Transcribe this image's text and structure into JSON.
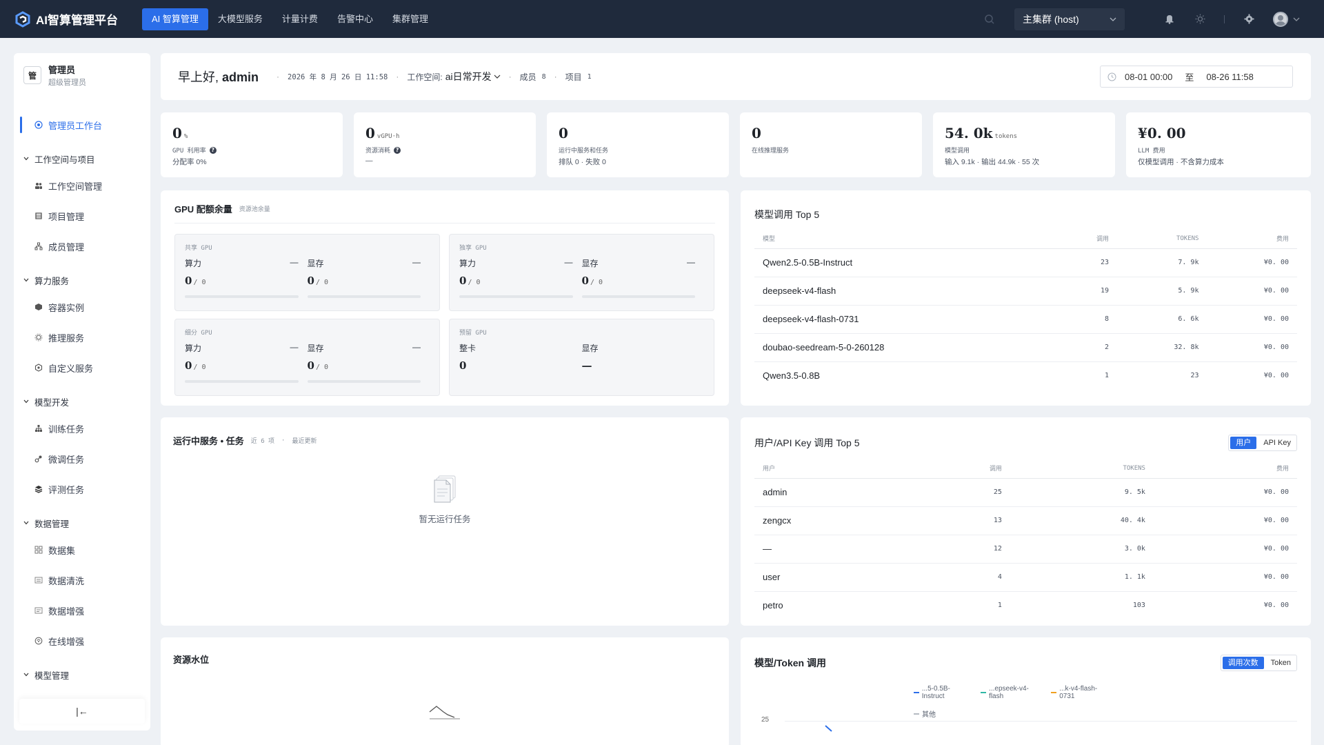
{
  "app": {
    "title": "AI智算管理平台"
  },
  "topnav": {
    "items": [
      {
        "label": "AI 智算管理",
        "active": true
      },
      {
        "label": "大模型服务",
        "active": false
      },
      {
        "label": "计量计费",
        "active": false
      },
      {
        "label": "告警中心",
        "active": false
      },
      {
        "label": "集群管理",
        "active": false
      }
    ],
    "cluster": "主集群 (host)"
  },
  "sidebar": {
    "admin": {
      "initial": "管",
      "name": "管理员",
      "role": "超级管理员"
    },
    "items": [
      {
        "label": "管理员工作台",
        "type": "item",
        "active": true,
        "icon": "dashboard-icon"
      },
      {
        "label": "工作空间与项目",
        "type": "group"
      },
      {
        "label": "工作空间管理",
        "type": "item",
        "icon": "workspace-icon"
      },
      {
        "label": "项目管理",
        "type": "item",
        "icon": "project-icon"
      },
      {
        "label": "成员管理",
        "type": "item",
        "icon": "members-icon"
      },
      {
        "label": "算力服务",
        "type": "group"
      },
      {
        "label": "容器实例",
        "type": "item",
        "icon": "container-icon"
      },
      {
        "label": "推理服务",
        "type": "item",
        "icon": "inference-icon"
      },
      {
        "label": "自定义服务",
        "type": "item",
        "icon": "custom-service-icon"
      },
      {
        "label": "模型开发",
        "type": "group"
      },
      {
        "label": "训练任务",
        "type": "item",
        "icon": "training-icon"
      },
      {
        "label": "微调任务",
        "type": "item",
        "icon": "finetune-icon"
      },
      {
        "label": "评测任务",
        "type": "item",
        "icon": "evaluation-icon"
      },
      {
        "label": "数据管理",
        "type": "group"
      },
      {
        "label": "数据集",
        "type": "item",
        "icon": "dataset-icon"
      },
      {
        "label": "数据清洗",
        "type": "item",
        "icon": "data-clean-icon"
      },
      {
        "label": "数据增强",
        "type": "item",
        "icon": "data-augment-icon"
      },
      {
        "label": "在线增强",
        "type": "item",
        "icon": "online-augment-icon"
      },
      {
        "label": "模型管理",
        "type": "group"
      }
    ],
    "collapse_glyph": "|←"
  },
  "greeting": {
    "prefix": "早上好,",
    "user": "admin",
    "date": "2026 年 8 月 26 日 11:58",
    "workspace_label": "工作空间:",
    "workspace_value": "ai日常开发",
    "members_label": "成员",
    "members_value": "8",
    "projects_label": "项目",
    "projects_value": "1",
    "date_from": "08-01 00:00",
    "date_to_sep": "至",
    "date_to": "08-26 11:58"
  },
  "stats": [
    {
      "value": "0",
      "unit": "%",
      "label": "GPU 利用率",
      "help": true,
      "sub": "分配率 0%"
    },
    {
      "value": "0",
      "unit": "vGPU·h",
      "label": "资源消耗",
      "help": true,
      "sub": "—"
    },
    {
      "value": "0",
      "unit": "",
      "label": "运行中服务和任务",
      "help": false,
      "sub": "排队 0 · 失败 0"
    },
    {
      "value": "0",
      "unit": "",
      "label": "在线推理服务",
      "help": false,
      "sub": ""
    },
    {
      "value": "54. 0k",
      "unit": "tokens",
      "label": "模型调用",
      "help": false,
      "sub": "输入 9.1k · 输出 44.9k · 55 次"
    },
    {
      "value": "¥0. 00",
      "unit": "",
      "label": "LLM 费用",
      "help": false,
      "sub": "仅模型调用 · 不含算力成本"
    }
  ],
  "gpu": {
    "title": "GPU 配额余量",
    "subtitle": "资源池余量",
    "boxes": [
      {
        "title": "共享 GPU",
        "left_label": "算力",
        "left_dash": "—",
        "left_val": "0",
        "left_total": "/ 0",
        "left_fill": 0,
        "right_label": "显存",
        "right_dash": "—",
        "right_val": "0",
        "right_total": "/ 0",
        "right_fill": 0
      },
      {
        "title": "独享 GPU",
        "left_label": "算力",
        "left_dash": "—",
        "left_val": "0",
        "left_total": "/ 0",
        "left_fill": 0,
        "right_label": "显存",
        "right_dash": "—",
        "right_val": "0",
        "right_total": "/ 0",
        "right_fill": 0
      },
      {
        "title": "细分 GPU",
        "left_label": "算力",
        "left_dash": "—",
        "left_val": "0",
        "left_total": "/ 0",
        "left_fill": 0,
        "right_label": "显存",
        "right_dash": "—",
        "right_val": "0",
        "right_total": "/ 0",
        "right_fill": 0
      },
      {
        "title": "预留 GPU",
        "left_label": "整卡",
        "left_dash": "",
        "left_val": "0",
        "left_total": "",
        "left_fill": null,
        "right_label": "显存",
        "right_dash": "",
        "right_val": "—",
        "right_total": "",
        "right_fill": null
      }
    ]
  },
  "running": {
    "title": "运行中服务 • 任务",
    "meta1": "近 6 项",
    "meta2": "最近更新",
    "empty": "暂无运行任务"
  },
  "resource": {
    "title": "资源水位"
  },
  "model_top": {
    "title": "模型调用 Top 5",
    "columns": [
      "模型",
      "调用",
      "TOKENS",
      "费用"
    ],
    "rows": [
      [
        "Qwen2.5-0.5B-Instruct",
        "23",
        "7. 9k",
        "¥0. 00"
      ],
      [
        "deepseek-v4-flash",
        "19",
        "5. 9k",
        "¥0. 00"
      ],
      [
        "deepseek-v4-flash-0731",
        "8",
        "6. 6k",
        "¥0. 00"
      ],
      [
        "doubao-seedream-5-0-260128",
        "2",
        "32. 8k",
        "¥0. 00"
      ],
      [
        "Qwen3.5-0.8B",
        "1",
        "23",
        "¥0. 00"
      ]
    ]
  },
  "user_top": {
    "title": "用户/API Key 调用 Top 5",
    "toggle": [
      "用户",
      "API Key"
    ],
    "columns": [
      "用户",
      "调用",
      "TOKENS",
      "费用"
    ],
    "rows": [
      [
        "admin",
        "25",
        "9. 5k",
        "¥0. 00"
      ],
      [
        "zengcx",
        "13",
        "40. 4k",
        "¥0. 00"
      ],
      [
        "—",
        "12",
        "3. 0k",
        "¥0. 00"
      ],
      [
        "user",
        "4",
        "1. 1k",
        "¥0. 00"
      ],
      [
        "petro",
        "1",
        "103",
        "¥0. 00"
      ]
    ]
  },
  "token_chart": {
    "title": "模型/Token 调用",
    "toggle": [
      "调用次数",
      "Token"
    ],
    "legend": [
      {
        "label": "...5-0.5B-Instruct",
        "color": "#2b6ee9"
      },
      {
        "label": "...epseek-v4-flash",
        "color": "#2fb8a5"
      },
      {
        "label": "...k-v4-flash-0731",
        "color": "#f0a020"
      },
      {
        "label": "其他",
        "color": "#b5bac2"
      }
    ],
    "y_tick": "25"
  }
}
